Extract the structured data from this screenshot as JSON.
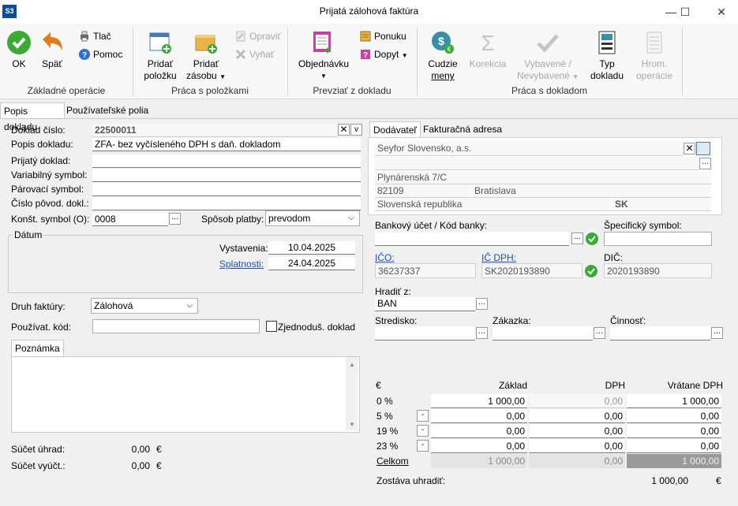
{
  "window": {
    "app_badge": "S3",
    "title": "Prijatá zálohová faktúra",
    "minimize": "—",
    "maximize": "☐",
    "close": "✕"
  },
  "ribbon": {
    "groups": {
      "basic": "Základné operácie",
      "items": "Práca s položkami",
      "take": "Prevziať z dokladu",
      "doc": "Práca s dokladom"
    },
    "ok": "OK",
    "back": "Späť",
    "print": "Tlač",
    "help": "Pomoc",
    "add_item_1": "Pridať",
    "add_item_2": "položku",
    "add_stock_1": "Pridať",
    "add_stock_2": "zásobu",
    "edit": "Opraviť",
    "cut": "Vyňať",
    "order_1": "Objednávku",
    "offer": "Ponuku",
    "inquiry": "Dopyt",
    "currency_1": "Cudzie",
    "currency_2": "meny",
    "correction": "Korekcia",
    "selected_1": "Vybavené /",
    "selected_2": "Nevybavené",
    "doctype_1": "Typ",
    "doctype_2": "dokladu",
    "bulk_1": "Hrom.",
    "bulk_2": "operácie"
  },
  "tabs": {
    "doc": "Popis dokladu",
    "user": "Používateľské polia"
  },
  "form": {
    "doc_no_label": "Doklad číslo:",
    "doc_no": "22500011",
    "desc_label": "Popis dokladu:",
    "desc": "ZFA- bez vyčísleného DPH s daň. dokladom",
    "received_label": "Prijatý doklad:",
    "varsym_label": "Variabilný symbol:",
    "pairsym_label": "Párovací symbol:",
    "origdoc_label": "Číslo pôvod. dokl.:",
    "constsym_label": "Konšt. symbol (O):",
    "constsym": "0008",
    "payment_label": "Spôsob platby:",
    "payment": "prevodom",
    "date_group": "Dátum",
    "issue_label": "Vystavenia:",
    "issue": "10.04.2025",
    "due_label": "Splatnosti:",
    "due": "24.04.2025",
    "invtype_label": "Druh faktúry:",
    "invtype": "Zálohová",
    "usercode_label": "Používat. kód:",
    "simple_label": "Zjednoduš. doklad",
    "note_tab": "Poznámka",
    "paid_label": "Súčet úhrad:",
    "paid": "0,00",
    "billed_label": "Súčet vyúčt.:",
    "billed": "0,00",
    "cur": "€"
  },
  "supplier": {
    "tab_supplier": "Dodávateľ",
    "tab_invoice": "Fakturačná adresa",
    "name": "Seyfor Slovensko, a.s.",
    "street": "Plynárenská 7/C",
    "zip": "82109",
    "city": "Bratislava",
    "country": "Slovenská republika",
    "country_code": "SK",
    "bank_label": "Bankový účet / Kód banky:",
    "specsym_label": "Špecifický symbol:",
    "ico_label": "IČO:",
    "ico": "36237337",
    "icdph_label": "IČ DPH:",
    "icdph": "SK2020193890",
    "dic_label": "DIČ:",
    "dic": "2020193890",
    "payby_label": "Hradiť z:",
    "payby": "BAN",
    "center_label": "Stredisko:",
    "order_label": "Zákazka:",
    "activity_label": "Činnosť:"
  },
  "vat": {
    "cur": "€",
    "col_base": "Základ",
    "col_vat": "DPH",
    "col_total": "Vrátane DPH",
    "rows": [
      {
        "rate": "0 %",
        "base": "1 000,00",
        "vat": "0,00",
        "total": "1 000,00"
      },
      {
        "rate": "5 %",
        "base": "0,00",
        "vat": "0,00",
        "total": "0,00"
      },
      {
        "rate": "19 %",
        "base": "0,00",
        "vat": "0,00",
        "total": "0,00"
      },
      {
        "rate": "23 %",
        "base": "0,00",
        "vat": "0,00",
        "total": "0,00"
      }
    ],
    "sum_label": "Celkom",
    "sum_base": "1 000,00",
    "sum_vat": "0,00",
    "sum_total": "1 000,00",
    "remain_label": "Zostáva uhradiť:",
    "remain": "1 000,00"
  }
}
